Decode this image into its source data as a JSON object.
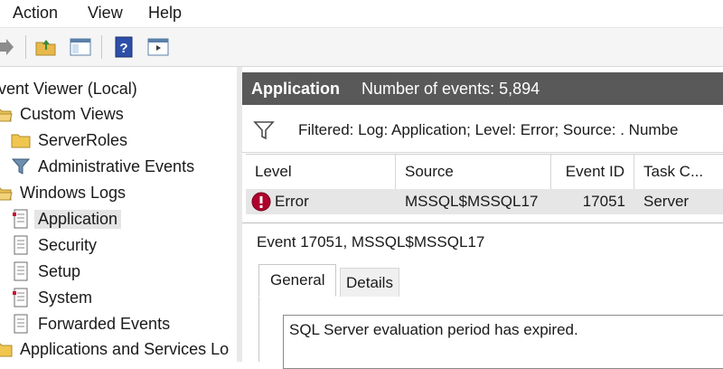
{
  "menu": [
    "Action",
    "View",
    "Help"
  ],
  "tree": {
    "root": "vent Viewer (Local)",
    "items": [
      {
        "label": "Custom Views",
        "icon": "folder-open-icon"
      },
      {
        "label": "ServerRoles",
        "icon": "folder-icon"
      },
      {
        "label": "Administrative Events",
        "icon": "filter-icon"
      },
      {
        "label": "Windows Logs",
        "icon": "folder-open-icon"
      },
      {
        "label": "Application",
        "icon": "log-icon",
        "selected": true
      },
      {
        "label": "Security",
        "icon": "log-icon"
      },
      {
        "label": "Setup",
        "icon": "log-icon"
      },
      {
        "label": "System",
        "icon": "log-icon"
      },
      {
        "label": "Forwarded Events",
        "icon": "log-icon"
      },
      {
        "label": "Applications and Services Lo",
        "icon": "folder-icon"
      }
    ]
  },
  "header": {
    "title": "Application",
    "count": "Number of events: 5,894"
  },
  "filter": {
    "text": "Filtered: Log: Application; Level: Error; Source: . Numbe"
  },
  "grid": {
    "columns": [
      "Level",
      "Source",
      "Event ID",
      "Task C..."
    ],
    "rows": [
      {
        "level": "Error",
        "source": "MSSQL$MSSQL17",
        "event_id": "17051",
        "task": "Server"
      }
    ]
  },
  "detail": {
    "title": "Event 17051, MSSQL$MSSQL17",
    "tabs": [
      "General",
      "Details"
    ],
    "description": "SQL Server evaluation period has expired."
  },
  "colors": {
    "header_bg": "#595959",
    "error_red": "#b0002e"
  }
}
